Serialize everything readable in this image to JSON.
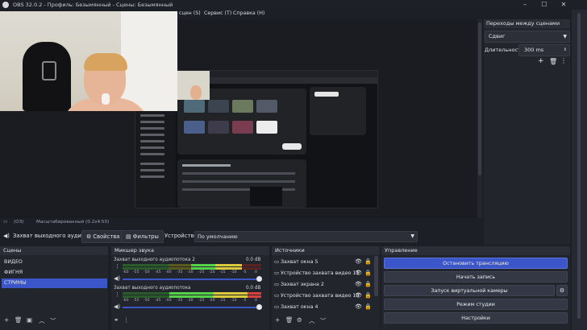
{
  "titlebar": {
    "title": "OBS 32.0.2 - Профиль: Безымянный - Сцены: Безымянный"
  },
  "menu": {
    "scenes": "сцен (S)",
    "service": "Сервис (T)",
    "help": "Справка (H)"
  },
  "preview": {
    "toolbar_left": "(ОЗ)",
    "toolbar_scale": "Масштабированный (0.2x4:50)"
  },
  "controls": {
    "source_label": "Захват выходного аудиот",
    "properties": "Свойства",
    "filters": "Фильтры",
    "device_label": "Устройство",
    "device_value": "По умолчанию"
  },
  "transitions": {
    "header": "Переходы между сценами",
    "type": "Сдвиг",
    "duration_label": "Длительность",
    "duration_value": "300 ms"
  },
  "scenes": {
    "header": "Сцены",
    "items": [
      "ВИДЕО",
      "ФИГНЯ",
      "СТРИМЫ"
    ],
    "selected_index": 2
  },
  "mixer": {
    "header": "Микшер звука",
    "channels": [
      {
        "name": "Захват выходного аудиопотока 2",
        "db": "0.0 dB"
      },
      {
        "name": "Захват выходного аудиопотока",
        "db": "0.0 dB"
      }
    ],
    "ticks": [
      "-60",
      "-55",
      "-50",
      "-45",
      "-40",
      "-35",
      "-30",
      "-25",
      "-20",
      "-15",
      "-10",
      "-5",
      "0"
    ]
  },
  "sources": {
    "header": "Источники",
    "items": [
      "Захват окна 5",
      "Устройство захвата видео 11",
      "Захват экрана 2",
      "Устройство захвата видео 10",
      "Захват окна 4"
    ]
  },
  "control_dock": {
    "header": "Управление",
    "buttons": [
      "Остановить трансляцию",
      "Начать запись",
      "Запуск виртуальной камеры",
      "Режим студии",
      "Настройки"
    ]
  },
  "colors": {
    "accent": "#3b56c8",
    "stop_button": "#3b56c8"
  }
}
